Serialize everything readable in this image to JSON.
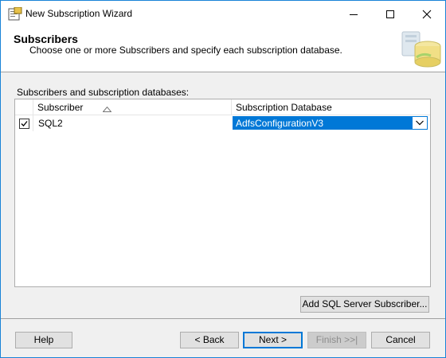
{
  "window": {
    "title": "New Subscription Wizard",
    "icon": "wizard-icon"
  },
  "header": {
    "title": "Subscribers",
    "subtitle": "Choose one or more Subscribers and specify each subscription database."
  },
  "grid": {
    "label": "Subscribers and subscription databases:",
    "columns": {
      "subscriber": "Subscriber",
      "database": "Subscription Database"
    },
    "sort_icon": "sort-ascending-icon",
    "rows": [
      {
        "checked": true,
        "subscriber": "SQL2",
        "database": "AdfsConfigurationV3"
      }
    ]
  },
  "buttons": {
    "add_subscriber": "Add SQL Server Subscriber...",
    "help": "Help",
    "back": "< Back",
    "next": "Next >",
    "finish": "Finish >>|",
    "cancel": "Cancel"
  },
  "colors": {
    "accent": "#0078d7",
    "selection": "#0078d7",
    "border": "#1883d7"
  }
}
